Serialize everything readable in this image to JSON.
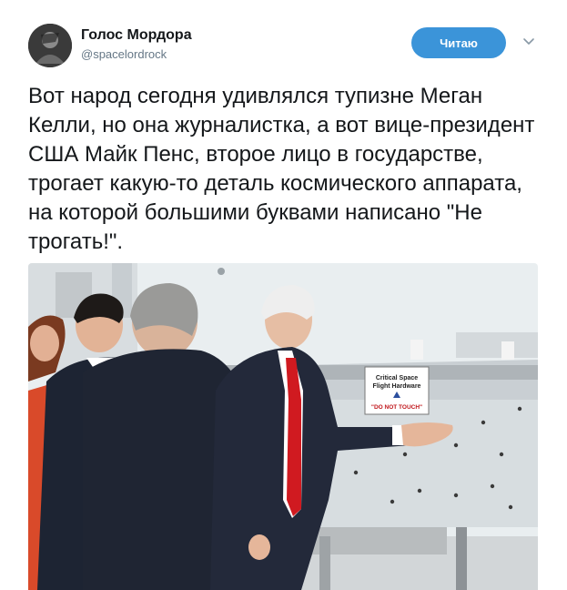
{
  "author": {
    "display_name": "Голос Мордора",
    "handle": "@spacelordrock",
    "avatar_icon": "user-avatar"
  },
  "follow_button": {
    "label": "Читаю",
    "color": "#3b94d9"
  },
  "menu": {
    "icon": "chevron-down-icon"
  },
  "tweet": {
    "text": "Вот народ сегодня удивлялся тупизне Меган Келли, но она журналистка, а вот вице-президент США Майк Пенс, второе лицо в государстве, трогает какую-то деталь космического аппарата, на которой большими буквами написано \"Не трогать!\"."
  },
  "photo": {
    "sign": {
      "line1": "Critical Space",
      "line2": "Flight Hardware",
      "warning": "\"DO NOT TOUCH\""
    }
  }
}
